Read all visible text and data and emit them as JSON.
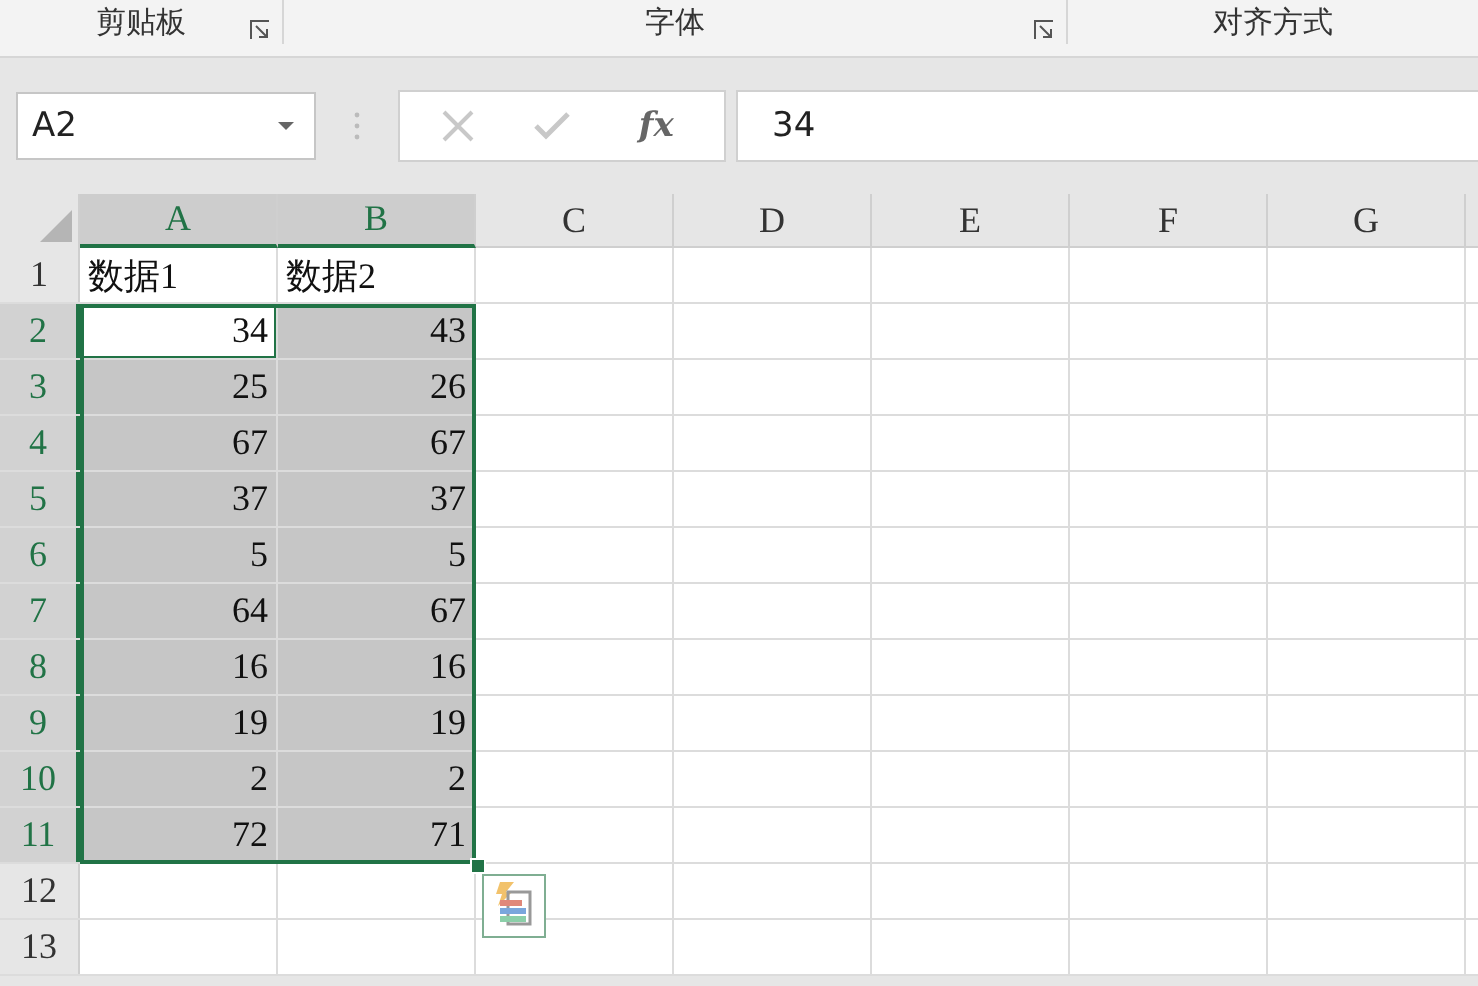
{
  "ribbon_groups": [
    {
      "label": "剪贴板",
      "launcher": true
    },
    {
      "label": "字体",
      "launcher": true
    },
    {
      "label": "对齐方式",
      "launcher": false
    }
  ],
  "name_box": {
    "value": "A2"
  },
  "formula_bar": {
    "function_button": "fx",
    "value": "34"
  },
  "columns": [
    {
      "label": "A",
      "selected": true
    },
    {
      "label": "B",
      "selected": true
    },
    {
      "label": "C",
      "selected": false
    },
    {
      "label": "D",
      "selected": false
    },
    {
      "label": "E",
      "selected": false
    },
    {
      "label": "F",
      "selected": false
    },
    {
      "label": "G",
      "selected": false
    }
  ],
  "rows": [
    {
      "header": "1",
      "selected": false,
      "cells": [
        {
          "text": "数据1",
          "kind": "text",
          "selected": false,
          "active": false
        },
        {
          "text": "数据2",
          "kind": "text",
          "selected": false,
          "active": false
        }
      ]
    },
    {
      "header": "2",
      "selected": true,
      "cells": [
        {
          "text": "34",
          "kind": "number",
          "selected": true,
          "active": true
        },
        {
          "text": "43",
          "kind": "number",
          "selected": true,
          "active": false
        }
      ]
    },
    {
      "header": "3",
      "selected": true,
      "cells": [
        {
          "text": "25",
          "kind": "number",
          "selected": true,
          "active": false
        },
        {
          "text": "26",
          "kind": "number",
          "selected": true,
          "active": false
        }
      ]
    },
    {
      "header": "4",
      "selected": true,
      "cells": [
        {
          "text": "67",
          "kind": "number",
          "selected": true,
          "active": false
        },
        {
          "text": "67",
          "kind": "number",
          "selected": true,
          "active": false
        }
      ]
    },
    {
      "header": "5",
      "selected": true,
      "cells": [
        {
          "text": "37",
          "kind": "number",
          "selected": true,
          "active": false
        },
        {
          "text": "37",
          "kind": "number",
          "selected": true,
          "active": false
        }
      ]
    },
    {
      "header": "6",
      "selected": true,
      "cells": [
        {
          "text": "5",
          "kind": "number",
          "selected": true,
          "active": false
        },
        {
          "text": "5",
          "kind": "number",
          "selected": true,
          "active": false
        }
      ]
    },
    {
      "header": "7",
      "selected": true,
      "cells": [
        {
          "text": "64",
          "kind": "number",
          "selected": true,
          "active": false
        },
        {
          "text": "67",
          "kind": "number",
          "selected": true,
          "active": false
        }
      ]
    },
    {
      "header": "8",
      "selected": true,
      "cells": [
        {
          "text": "16",
          "kind": "number",
          "selected": true,
          "active": false
        },
        {
          "text": "16",
          "kind": "number",
          "selected": true,
          "active": false
        }
      ]
    },
    {
      "header": "9",
      "selected": true,
      "cells": [
        {
          "text": "19",
          "kind": "number",
          "selected": true,
          "active": false
        },
        {
          "text": "19",
          "kind": "number",
          "selected": true,
          "active": false
        }
      ]
    },
    {
      "header": "10",
      "selected": true,
      "cells": [
        {
          "text": "2",
          "kind": "number",
          "selected": true,
          "active": false
        },
        {
          "text": "2",
          "kind": "number",
          "selected": true,
          "active": false
        }
      ]
    },
    {
      "header": "11",
      "selected": true,
      "cells": [
        {
          "text": "72",
          "kind": "number",
          "selected": true,
          "active": false
        },
        {
          "text": "71",
          "kind": "number",
          "selected": true,
          "active": false
        }
      ]
    },
    {
      "header": "12",
      "selected": false
    },
    {
      "header": "13",
      "selected": false
    }
  ]
}
